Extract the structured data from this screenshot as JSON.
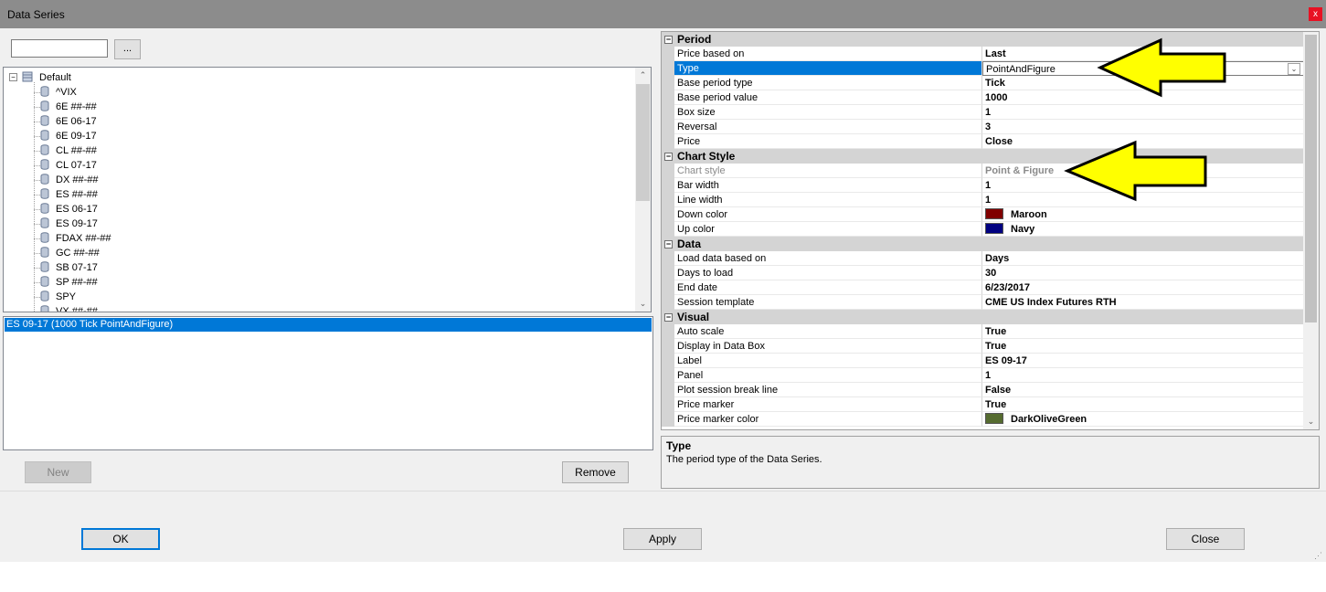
{
  "window": {
    "title": "Data Series",
    "close_glyph": "x"
  },
  "search": {
    "value": "",
    "browse_label": "..."
  },
  "tree": {
    "root": "Default",
    "items": [
      "^VIX",
      "6E ##-##",
      "6E 06-17",
      "6E 09-17",
      "CL ##-##",
      "CL 07-17",
      "DX ##-##",
      "ES ##-##",
      "ES 06-17",
      "ES 09-17",
      "FDAX ##-##",
      "GC ##-##",
      "SB 07-17",
      "SP ##-##",
      "SPY",
      "VX ##-##"
    ]
  },
  "series_list": {
    "selected": "ES 09-17 (1000 Tick PointAndFigure)"
  },
  "buttons": {
    "new": "New",
    "remove": "Remove",
    "ok": "OK",
    "apply": "Apply",
    "close": "Close"
  },
  "grid": {
    "period": {
      "title": "Period",
      "rows": [
        {
          "name": "Price based on",
          "value": "Last"
        },
        {
          "name": "Type",
          "value": "PointAndFigure"
        },
        {
          "name": "Base period type",
          "value": "Tick"
        },
        {
          "name": "Base period value",
          "value": "1000"
        },
        {
          "name": "Box size",
          "value": "1"
        },
        {
          "name": "Reversal",
          "value": "3"
        },
        {
          "name": "Price",
          "value": "Close"
        }
      ]
    },
    "chart_style": {
      "title": "Chart Style",
      "rows": [
        {
          "name": "Chart style",
          "value": "Point & Figure"
        },
        {
          "name": "Bar width",
          "value": "1"
        },
        {
          "name": "Line width",
          "value": "1"
        },
        {
          "name": "Down color",
          "value": "Maroon",
          "swatch": "#800000"
        },
        {
          "name": "Up color",
          "value": "Navy",
          "swatch": "#000080"
        }
      ]
    },
    "data": {
      "title": "Data",
      "rows": [
        {
          "name": "Load data based on",
          "value": "Days"
        },
        {
          "name": "Days to load",
          "value": "30"
        },
        {
          "name": "End date",
          "value": "6/23/2017"
        },
        {
          "name": "Session template",
          "value": "CME US Index Futures RTH"
        }
      ]
    },
    "visual": {
      "title": "Visual",
      "rows": [
        {
          "name": "Auto scale",
          "value": "True"
        },
        {
          "name": "Display in Data Box",
          "value": "True"
        },
        {
          "name": "Label",
          "value": "ES 09-17"
        },
        {
          "name": "Panel",
          "value": "1"
        },
        {
          "name": "Plot session break line",
          "value": "False"
        },
        {
          "name": "Price marker",
          "value": "True"
        },
        {
          "name": "Price marker color",
          "value": "DarkOliveGreen",
          "swatch": "#556b2f"
        }
      ]
    }
  },
  "help": {
    "title": "Type",
    "text": "The period type of the Data Series."
  },
  "colors": {
    "selection": "#0078d7",
    "arrow": "#ffff00"
  }
}
